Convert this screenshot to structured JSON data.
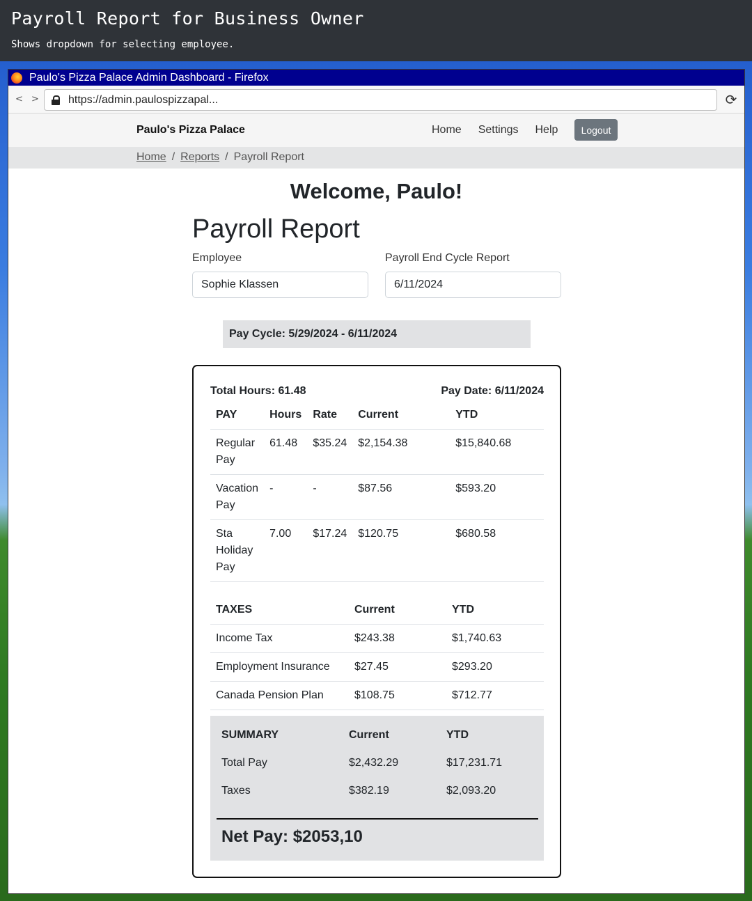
{
  "caption": {
    "title": "Payroll Report for Business Owner",
    "subtitle": "Shows dropdown for selecting employee."
  },
  "browser": {
    "window_title": "Paulo's Pizza Palace Admin Dashboard - Firefox",
    "nav_arrows": "< >",
    "url": "https://admin.paulospizzapal..."
  },
  "navbar": {
    "brand": "Paulo's Pizza Palace",
    "links": [
      "Home",
      "Settings",
      "Help"
    ],
    "logout": "Logout"
  },
  "breadcrumb": {
    "items": [
      "Home",
      "Reports"
    ],
    "current": "Payroll Report",
    "separator": "/"
  },
  "main": {
    "welcome": "Welcome, Paulo!",
    "title": "Payroll Report",
    "employee_label": "Employee",
    "employee_value": "Sophie Klassen",
    "end_cycle_label": "Payroll End Cycle Report",
    "end_cycle_value": "6/11/2024",
    "pay_cycle": "Pay Cycle: 5/29/2024 - 6/11/2024"
  },
  "report": {
    "total_hours": "Total Hours: 61.48",
    "pay_date": "Pay Date: 6/11/2024",
    "pay_headers": [
      "PAY",
      "Hours",
      "Rate",
      "Current",
      "YTD"
    ],
    "pay_rows": [
      [
        "Regular Pay",
        "61.48",
        "$35.24",
        "$2,154.38",
        "$15,840.68"
      ],
      [
        "Vacation Pay",
        "-",
        "-",
        "$87.56",
        "$593.20"
      ],
      [
        "Sta Holiday Pay",
        "7.00",
        "$17.24",
        "$120.75",
        "$680.58"
      ]
    ],
    "tax_headers": [
      "TAXES",
      "Current",
      "YTD"
    ],
    "tax_rows": [
      [
        "Income Tax",
        "$243.38",
        "$1,740.63"
      ],
      [
        "Employment Insurance",
        "$27.45",
        "$293.20"
      ],
      [
        "Canada Pension Plan",
        "$108.75",
        "$712.77"
      ]
    ],
    "summary_headers": [
      "SUMMARY",
      "Current",
      "YTD"
    ],
    "summary_rows": [
      [
        "Total Pay",
        "$2,432.29",
        "$17,231.71"
      ],
      [
        "Taxes",
        "$382.19",
        "$2,093.20"
      ]
    ],
    "net_pay": "Net Pay: $2053,10"
  }
}
